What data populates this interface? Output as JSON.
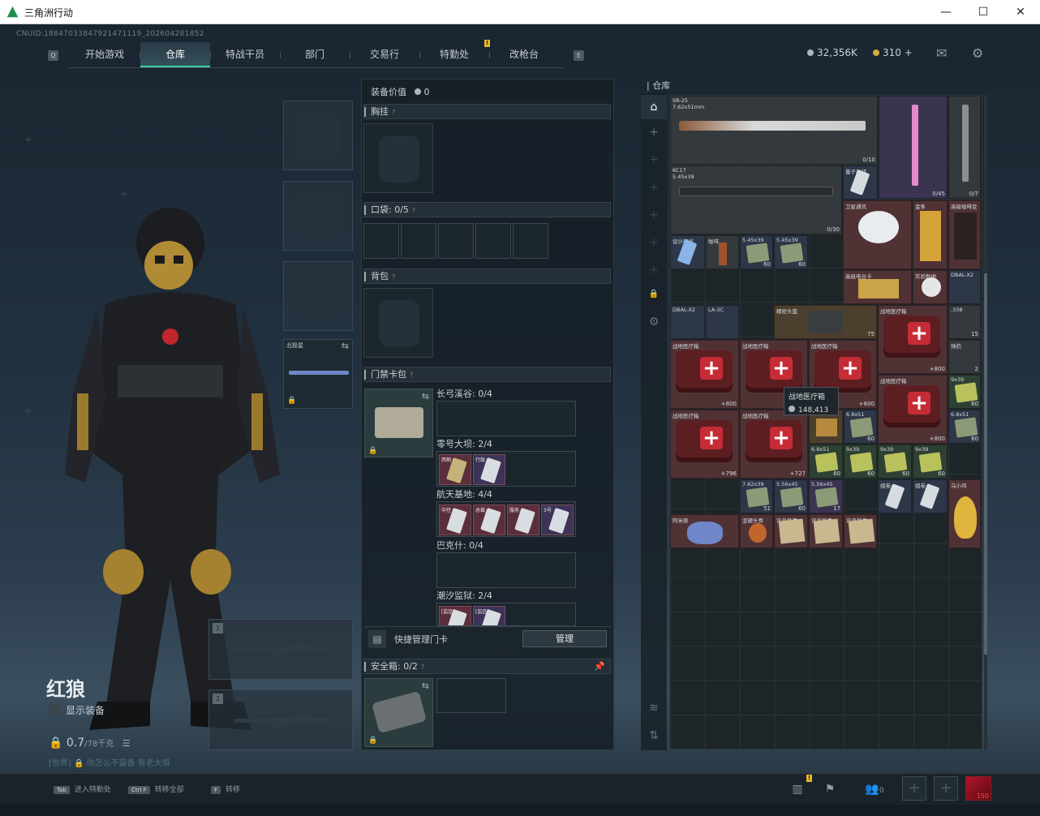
{
  "window": {
    "title": "三角洲行动",
    "min": "—",
    "max": "☐",
    "close": "✕"
  },
  "uid": "CNUID:18847033847921471119_202604281852",
  "nav": {
    "left_key": "Q",
    "right_key": "E",
    "tabs": [
      "开始游戏",
      "仓库",
      "特战干员",
      "部门",
      "交易行",
      "特勤处",
      "改枪台"
    ],
    "active": "仓库"
  },
  "currency": {
    "silver": "32,356K",
    "gold": "310 +"
  },
  "operator": {
    "name": "红狼",
    "show_equip": "显示装备",
    "weight": "0.7",
    "weight_unit": "/78千克",
    "chat": "[世界] 🔒 你怎么不装备 有老大哥"
  },
  "char_slots": {
    "melee_label": "北极星"
  },
  "gun_slots": [
    "1",
    "2"
  ],
  "equip_value": {
    "label": "装备价值",
    "value": "0"
  },
  "sections": {
    "chest": "胸挂",
    "pocket": "口袋:",
    "pocket_count": "0/5",
    "backpack": "背包",
    "keycard": "门禁卡包",
    "safe": "安全箱:",
    "safe_count": "0/2"
  },
  "key_rows": [
    {
      "label": "长弓溪谷: 0/4",
      "cards": []
    },
    {
      "label": "零号大坝: 2/4",
      "cards": [
        {
          "name": "西侧",
          "kind": "red"
        },
        {
          "name": "行政",
          "kind": "purple"
        }
      ]
    },
    {
      "label": "航天基地: 4/4",
      "cards": [
        {
          "name": "中控",
          "kind": "red"
        },
        {
          "name": "总裁",
          "kind": "red"
        },
        {
          "name": "服务",
          "kind": "red"
        },
        {
          "name": "3号",
          "kind": "purple"
        }
      ]
    },
    {
      "label": "巴克什: 0/4",
      "cards": []
    },
    {
      "label": "潮汐监狱: 2/4",
      "cards": [
        {
          "name": "[监区]",
          "kind": "red"
        },
        {
          "name": "[监区]",
          "kind": "purple"
        }
      ]
    }
  ],
  "quick": {
    "label": "快捷管理门卡",
    "button": "管理"
  },
  "warehouse": {
    "title": "仓库"
  },
  "items": {
    "sr25": {
      "name": "SR-25",
      "sub": "7.62x51mm",
      "count": "0/10"
    },
    "kc17": {
      "name": "KC17",
      "sub": "5.45x39",
      "count": "0/30"
    },
    "pinkgun": {
      "count": "0/45"
    },
    "rifle3": {
      "count": "0/7"
    },
    "quantum": {
      "name": "量子存储"
    },
    "satellite": {
      "name": "卫星通讯"
    },
    "gold": {
      "name": "金条"
    },
    "coffee": {
      "name": "高级咖啡豆"
    },
    "design": {
      "name": "设计图纸"
    },
    "drink": {
      "name": "咖啡"
    },
    "ammo1": {
      "name": "5.45x39",
      "count": "60"
    },
    "ammo2": {
      "name": "5.45x39",
      "count": "60"
    },
    "cardpack": {
      "name": "高级电台卡"
    },
    "disc": {
      "name": "实验数据"
    },
    "dbal1": {
      "name": "DBAL-X2"
    },
    "dbal2": {
      "name": "DBAL-X2"
    },
    "la3c": {
      "name": "LA-3C"
    },
    "bag": {
      "name": "精密头盔"
    },
    "bagcount": {
      "count": "75"
    },
    "med": [
      {
        "name": "战地医疗箱",
        "count": "+800"
      },
      {
        "name": "战地医疗箱",
        "count": "+800"
      },
      {
        "name": "战地医疗箱",
        "count": ""
      },
      {
        "name": "战地医疗箱",
        "count": "+800"
      },
      {
        "name": "战地医疗箱",
        "count": "+800"
      },
      {
        "name": "战地医疗箱",
        "count": "+796"
      },
      {
        "name": "战地医疗箱",
        "count": "+727"
      }
    ],
    "r338": {
      "name": ".338",
      "count": "15"
    },
    "r2": {
      "name": "弹药",
      "count": "2"
    },
    "a939a": {
      "name": "9x39",
      "count": "60"
    },
    "a651a": {
      "name": "6.8x51",
      "count": "60"
    },
    "tooltip": {
      "name": "战地医疗箱",
      "value": "148,413"
    },
    "ammo_row": [
      {
        "name": "6.8x51",
        "count": "60"
      },
      {
        "name": "6.8x51",
        "count": "60"
      },
      {
        "name": "9x39",
        "count": "60"
      },
      {
        "name": "9x39",
        "count": "60"
      },
      {
        "name": "9x39",
        "count": "60"
      },
      {
        "name": "9x39",
        "count": "60"
      }
    ],
    "ammo_row2": [
      {
        "name": "7.62x39",
        "count": "51"
      },
      {
        "name": "5.56x45",
        "count": "60"
      },
      {
        "name": "5.56x45",
        "count": "17"
      },
      {
        "name": "组卷",
        "count": ""
      },
      {
        "name": "组卷",
        "count": ""
      },
      {
        "name": "乌小鸡",
        "count": ""
      }
    ],
    "last_row": [
      {
        "name": "阿米娅",
        "count": ""
      },
      {
        "name": "坚硬头骨",
        "count": ""
      },
      {
        "name": "讯息残页",
        "count": ""
      },
      {
        "name": "讯息残页",
        "count": ""
      },
      {
        "name": "讯息残页",
        "count": ""
      }
    ]
  },
  "bottom": {
    "hints": [
      {
        "key": "Tab",
        "label": "进入特勤处"
      },
      {
        "key": "Ctrl F",
        "label": "转移全部"
      },
      {
        "key": "F",
        "label": "转移"
      }
    ],
    "friends": "0",
    "avatar_level": "150"
  }
}
